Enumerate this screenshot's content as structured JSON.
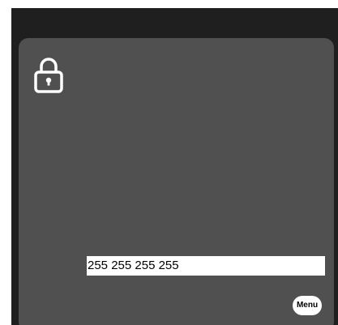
{
  "screen": {
    "background_color": "#1f1f1f",
    "panel_color": "#505050"
  },
  "lock": {
    "icon": "lock-icon"
  },
  "field": {
    "value": "255 255 255 255"
  },
  "menu": {
    "label": "Menu"
  }
}
